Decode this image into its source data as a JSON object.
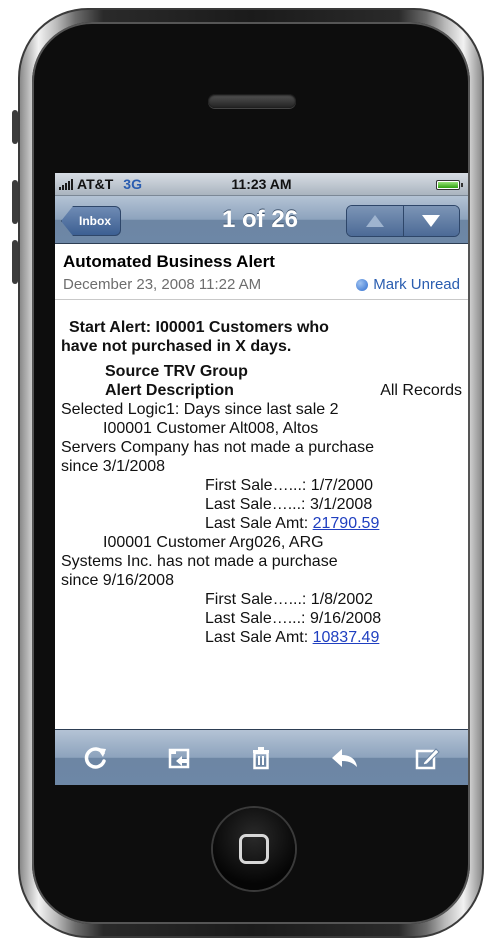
{
  "status": {
    "carrier": "AT&T",
    "network": "3G",
    "time": "11:23 AM"
  },
  "nav": {
    "back_label": "Inbox",
    "counter": "1 of 26"
  },
  "message": {
    "subject": "Automated Business Alert",
    "date": "December 23, 2008 11:22 AM",
    "mark_unread": "Mark Unread",
    "body": {
      "line1": "Start Alert:   I00001    Customers who",
      "line2": "have not purchased in X days.",
      "line3": "Source  TRV Group",
      "line4a": "Alert    Description",
      "line4b": "All Records",
      "line5": "Selected    Logic1: Days since last sale 2",
      "c1_line1": "I00001    Customer Alt008,  Altos",
      "c1_line2": "Servers Company has not made a purchase",
      "c1_line3": "since 3/1/2008",
      "c1_first": "First Sale…...: 1/7/2000",
      "c1_last": "Last Sale…...: 3/1/2008",
      "c1_amt_label": "Last Sale Amt: ",
      "c1_amt": "21790.59",
      "c2_line1": "I00001    Customer Arg026,  ARG",
      "c2_line2": "Systems Inc. has not made a purchase",
      "c2_line3": "since 9/16/2008",
      "c2_first": "First Sale…...: 1/8/2002",
      "c2_last": "Last Sale…...: 9/16/2008",
      "c2_amt_label": "Last Sale Amt: ",
      "c2_amt": "10837.49"
    }
  },
  "toolbar": [
    "refresh-icon",
    "folder-icon",
    "trash-icon",
    "reply-icon",
    "compose-icon"
  ],
  "colors": {
    "accent": "#2a5db0",
    "bar": "#7d95b4",
    "link": "#1f3fc0"
  }
}
